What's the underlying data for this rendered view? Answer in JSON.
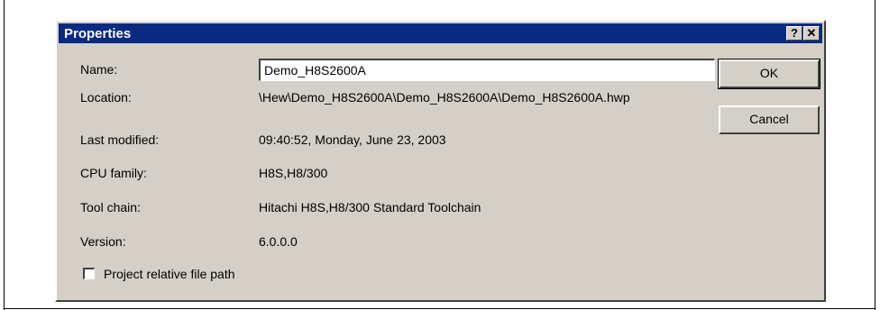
{
  "dialog": {
    "title": "Properties",
    "help_button": "?",
    "close_button": "✕"
  },
  "fields": {
    "name": {
      "label": "Name:",
      "value": "Demo_H8S2600A"
    },
    "location": {
      "label": "Location:",
      "value": "\\Hew\\Demo_H8S2600A\\Demo_H8S2600A\\Demo_H8S2600A.hwp"
    },
    "last_modified": {
      "label": "Last modified:",
      "value": "09:40:52, Monday, June 23, 2003"
    },
    "cpu_family": {
      "label": "CPU family:",
      "value": "H8S,H8/300"
    },
    "tool_chain": {
      "label": "Tool chain:",
      "value": "Hitachi H8S,H8/300 Standard Toolchain"
    },
    "version": {
      "label": "Version:",
      "value": "6.0.0.0"
    }
  },
  "buttons": {
    "ok": "OK",
    "cancel": "Cancel"
  },
  "checkbox": {
    "label": "Project relative file path",
    "checked": false
  }
}
